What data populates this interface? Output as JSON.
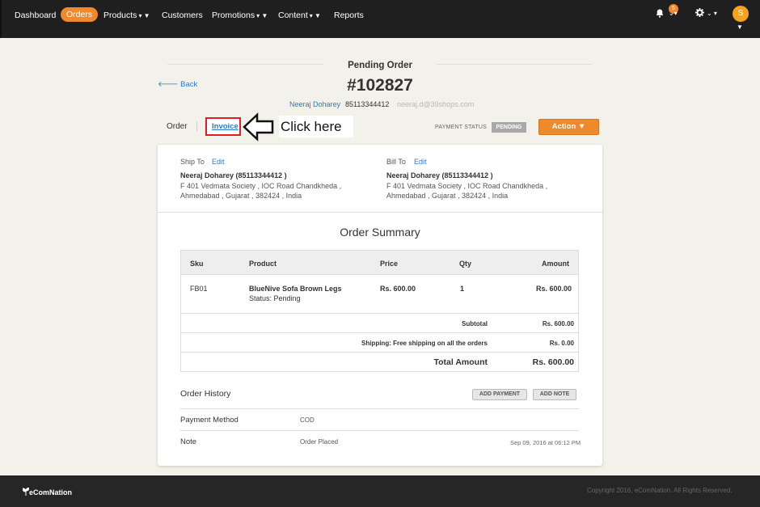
{
  "nav": {
    "items": [
      {
        "label": "Dashboard"
      },
      {
        "label": "Orders"
      },
      {
        "label": "Products",
        "caret": "▾ ▼"
      },
      {
        "label": "Customers"
      },
      {
        "label": "Promotions",
        "caret": "▾ ▼"
      },
      {
        "label": "Content",
        "caret": "▾ ▼"
      },
      {
        "label": "Reports"
      }
    ],
    "notifications_count": "5",
    "avatar_initial": "S"
  },
  "header": {
    "title": "Pending Order",
    "back": "🡐 Back",
    "order_number": "#102827",
    "customer_name": "Neeraj Doharey",
    "customer_phone": "85113344412",
    "customer_email": "neeraj.d@39shops.com"
  },
  "tabs": {
    "order": "Order",
    "invoice": "Invoice"
  },
  "annotation": {
    "text": "Click here"
  },
  "status": {
    "label": "PAYMENT STATUS",
    "value": "PENDING",
    "action": "Action ▼"
  },
  "ship_to": {
    "label": "Ship To",
    "edit": "Edit",
    "name": "Neeraj Doharey (85113344412 )",
    "line1": "F 401 Vedmata Society , IOC Road Chandkheda ,",
    "line2": "Ahmedabad , Gujarat , 382424 , India"
  },
  "bill_to": {
    "label": "Bill To",
    "edit": "Edit",
    "name": "Neeraj Doharey (85113344412 )",
    "line1": "F 401 Vedmata Society , IOC Road Chandkheda ,",
    "line2": "Ahmedabad , Gujarat , 382424 , India"
  },
  "summary": {
    "title": "Order Summary",
    "columns": [
      "Sku",
      "Product",
      "Price",
      "Qty",
      "Amount"
    ],
    "row": {
      "sku": "FB01",
      "product": "BlueNive Sofa Brown Legs",
      "status": "Status: Pending",
      "price": "Rs. 600.00",
      "qty": "1",
      "amount": "Rs. 600.00"
    },
    "subtotal_label": "Subtotal",
    "subtotal": "Rs. 600.00",
    "shipping_label": "Shipping:  Free shipping on all the orders",
    "shipping": "Rs. 0.00",
    "total_label": "Total Amount",
    "total": "Rs. 600.00"
  },
  "history": {
    "title": "Order History",
    "add_payment": "ADD PAYMENT",
    "add_note": "ADD NOTE",
    "payment_method_label": "Payment Method",
    "payment_method": "COD",
    "note_label": "Note",
    "note": "Order Placed",
    "note_date": "Sep 09, 2016 at 06:12 PM"
  },
  "footer": {
    "brand": "eComNation",
    "copyright": "Copyright 2016, eComNation. All Rights Reserved."
  },
  "colors": {
    "accent": "#f0892a",
    "link": "#2a7cc7",
    "highlight": "#e02020"
  }
}
